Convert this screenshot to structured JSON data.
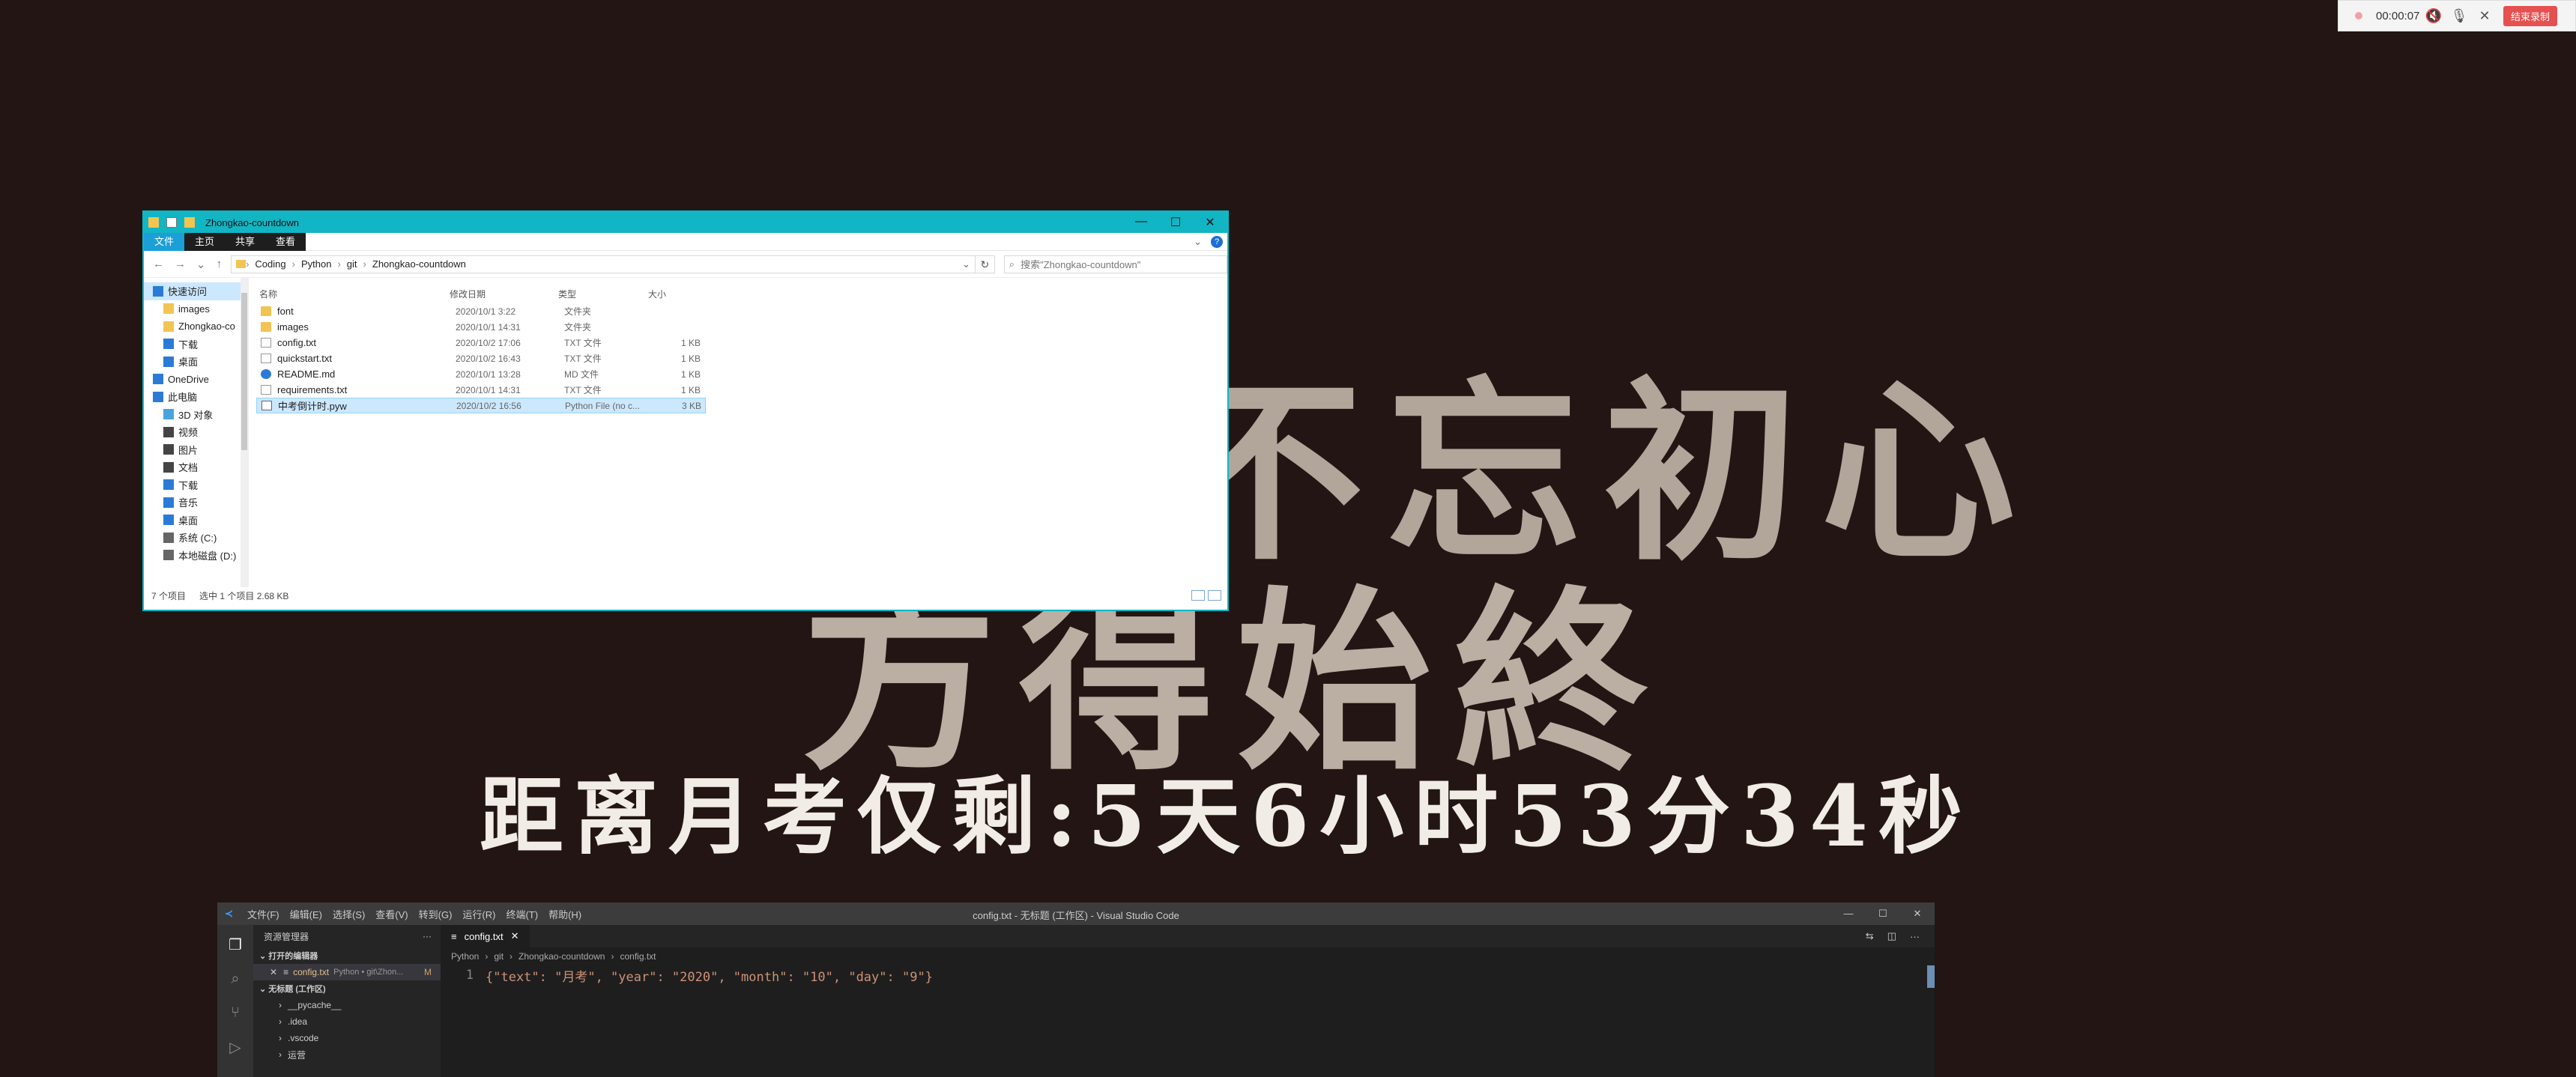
{
  "background": {
    "line1": "不忘初心",
    "line2": "方得始終",
    "countdown": "距离月考仅剩:5天6小时53分34秒"
  },
  "recorder": {
    "time": "00:00:07",
    "end_label": "结束录制"
  },
  "explorer": {
    "title": "Zhongkao-countdown",
    "ribbon_tabs": [
      "文件",
      "主页",
      "共享",
      "查看"
    ],
    "breadcrumbs": [
      "Coding",
      "Python",
      "git",
      "Zhongkao-countdown"
    ],
    "search_placeholder": "搜索\"Zhongkao-countdown\"",
    "nav_items": [
      {
        "label": "快速访问",
        "icon": "star-icon"
      },
      {
        "label": "images",
        "icon": "folder-icon"
      },
      {
        "label": "Zhongkao-co",
        "icon": "folder-icon"
      },
      {
        "label": "下载",
        "icon": "download-icon"
      },
      {
        "label": "桌面",
        "icon": "desktop-icon"
      },
      {
        "label": "OneDrive",
        "icon": "cloud-icon"
      },
      {
        "label": "此电脑",
        "icon": "computer-icon"
      },
      {
        "label": "3D 对象",
        "icon": "cube-icon"
      },
      {
        "label": "视频",
        "icon": "video-icon"
      },
      {
        "label": "图片",
        "icon": "picture-icon"
      },
      {
        "label": "文档",
        "icon": "document-icon"
      },
      {
        "label": "下载",
        "icon": "download-icon"
      },
      {
        "label": "音乐",
        "icon": "music-icon"
      },
      {
        "label": "桌面",
        "icon": "desktop-icon"
      },
      {
        "label": "系统 (C:)",
        "icon": "drive-icon"
      },
      {
        "label": "本地磁盘 (D:)",
        "icon": "drive-icon"
      }
    ],
    "columns": {
      "name": "名称",
      "date": "修改日期",
      "type": "类型",
      "size": "大小"
    },
    "files": [
      {
        "name": "font",
        "date": "2020/10/1 3:22",
        "type": "文件夹",
        "size": "",
        "kind": "folder"
      },
      {
        "name": "images",
        "date": "2020/10/1 14:31",
        "type": "文件夹",
        "size": "",
        "kind": "folder"
      },
      {
        "name": "config.txt",
        "date": "2020/10/2 17:06",
        "type": "TXT 文件",
        "size": "1 KB",
        "kind": "txt"
      },
      {
        "name": "quickstart.txt",
        "date": "2020/10/2 16:43",
        "type": "TXT 文件",
        "size": "1 KB",
        "kind": "txt"
      },
      {
        "name": "README.md",
        "date": "2020/10/1 13:28",
        "type": "MD 文件",
        "size": "1 KB",
        "kind": "md"
      },
      {
        "name": "requirements.txt",
        "date": "2020/10/1 14:31",
        "type": "TXT 文件",
        "size": "1 KB",
        "kind": "txt"
      },
      {
        "name": "中考倒计时.pyw",
        "date": "2020/10/2 16:56",
        "type": "Python File (no c...",
        "size": "3 KB",
        "kind": "py"
      }
    ],
    "status_count": "7 个项目",
    "status_selected": "选中 1 个项目  2.68 KB"
  },
  "vscode": {
    "menu": [
      "文件(F)",
      "编辑(E)",
      "选择(S)",
      "查看(V)",
      "转到(G)",
      "运行(R)",
      "终端(T)",
      "帮助(H)"
    ],
    "window_title": "config.txt - 无标题 (工作区) - Visual Studio Code",
    "explorer_header": "资源管理器",
    "open_editors_label": "打开的编辑器",
    "open_file": "config.txt",
    "open_file_path": "Python • git\\Zhon...",
    "open_file_status": "M",
    "workspace_label": "无标题 (工作区)",
    "tree": [
      "__pycache__",
      ".idea",
      ".vscode",
      "运营"
    ],
    "tab": "config.txt",
    "crumbs": [
      "Python",
      "git",
      "Zhongkao-countdown",
      "config.txt"
    ],
    "line_number": "1",
    "code": "{\"text\": \"月考\", \"year\": \"2020\", \"month\": \"10\", \"day\": \"9\"}"
  }
}
